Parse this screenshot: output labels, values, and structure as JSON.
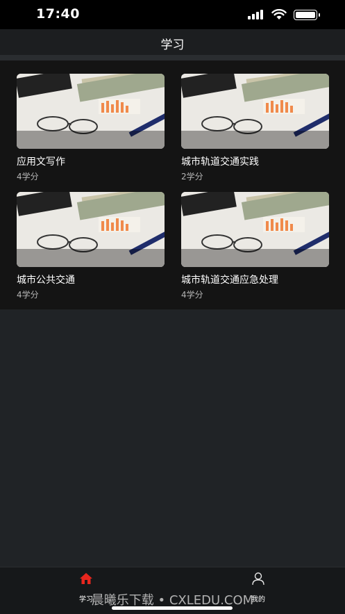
{
  "status_bar": {
    "time": "17:40"
  },
  "nav": {
    "title": "学习"
  },
  "courses": [
    {
      "name": "应用文写作",
      "credits": "4学分"
    },
    {
      "name": "城市轨道交通实践",
      "credits": "2学分"
    },
    {
      "name": "城市公共交通",
      "credits": "4学分"
    },
    {
      "name": "城市轨道交通应急处理",
      "credits": "4学分"
    }
  ],
  "tabs": [
    {
      "label": "学习",
      "icon": "home-icon",
      "active": true
    },
    {
      "label": "我的",
      "icon": "user-icon",
      "active": false
    }
  ],
  "watermark": "晨曦乐下载 • CXLEDU.COM",
  "colors": {
    "background": "#202326",
    "panel": "#141414",
    "active_tab_icon": "#e8261e",
    "text_secondary": "#b5b5b5"
  }
}
